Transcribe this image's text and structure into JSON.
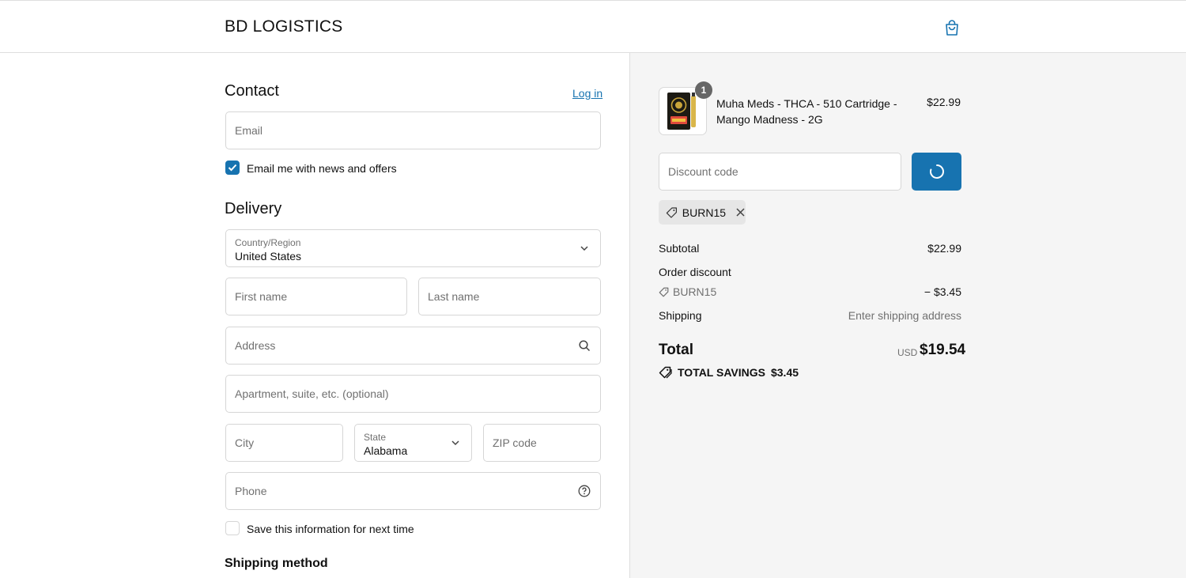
{
  "header": {
    "brand": "BD LOGISTICS",
    "cart_icon": "shopping-bag-icon"
  },
  "contact": {
    "title": "Contact",
    "login_link": "Log in",
    "email_placeholder": "Email",
    "newsletter_label": "Email me with news and offers",
    "newsletter_checked": true
  },
  "delivery": {
    "title": "Delivery",
    "country_label": "Country/Region",
    "country_value": "United States",
    "first_name_placeholder": "First name",
    "last_name_placeholder": "Last name",
    "address_placeholder": "Address",
    "apartment_placeholder": "Apartment, suite, etc. (optional)",
    "city_placeholder": "City",
    "state_label": "State",
    "state_value": "Alabama",
    "zip_placeholder": "ZIP code",
    "phone_placeholder": "Phone",
    "save_info_label": "Save this information for next time",
    "save_info_checked": false,
    "shipping_method_title": "Shipping method"
  },
  "summary": {
    "item": {
      "quantity": "1",
      "name": "Muha Meds - THCA - 510 Cartridge - Mango Madness - 2G",
      "price": "$22.99"
    },
    "discount_placeholder": "Discount code",
    "applied_code": "BURN15",
    "subtotal_label": "Subtotal",
    "subtotal_value": "$22.99",
    "order_discount_label": "Order discount",
    "discount_code": "BURN15",
    "discount_value": "− $3.45",
    "shipping_label": "Shipping",
    "shipping_value": "Enter shipping address",
    "total_label": "Total",
    "total_currency": "USD",
    "total_value": "$19.54",
    "savings_label": "TOTAL SAVINGS",
    "savings_value": "$3.45"
  },
  "colors": {
    "accent": "#1773b0",
    "summary_bg": "#f5f5f5"
  }
}
